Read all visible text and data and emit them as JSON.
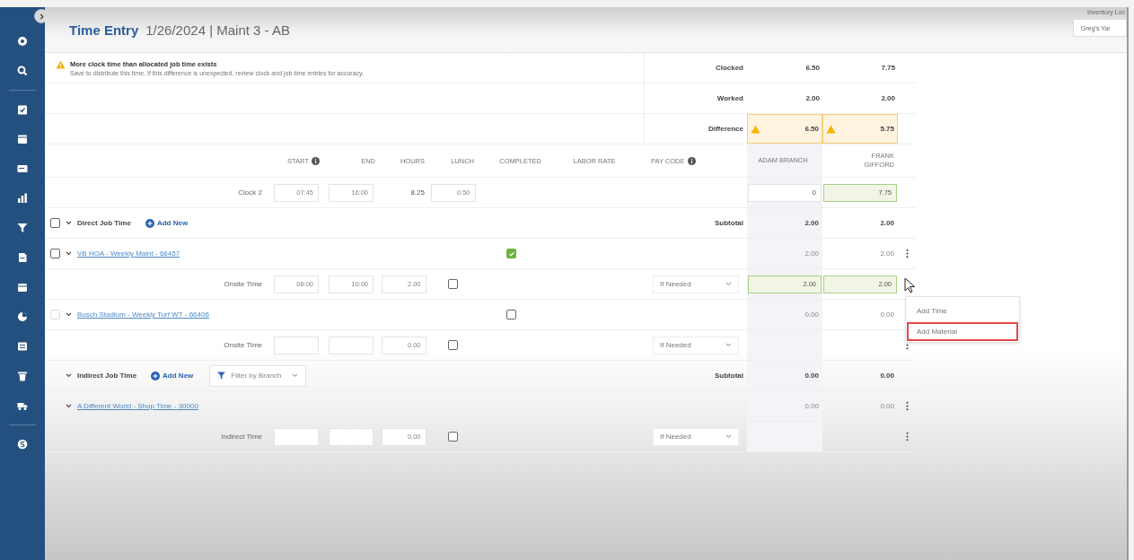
{
  "header": {
    "title": "Time Entry",
    "subtitle": "1/26/2024 | Maint 3 - AB",
    "location_label": "Inventory Loc",
    "location_value": "Greg's Yar"
  },
  "alert": {
    "title": "More clock time than allocated job time exists",
    "message": "Save to distribute this time. If this difference is unexpected, review clock and job time entries for accuracy."
  },
  "summary": [
    {
      "label": "Clocked",
      "values": [
        "6.50",
        "7.75"
      ],
      "warning": false
    },
    {
      "label": "Worked",
      "values": [
        "2.00",
        "2.00"
      ],
      "warning": false
    },
    {
      "label": "Difference",
      "values": [
        "6.50",
        "5.75"
      ],
      "warning": true
    }
  ],
  "columns": [
    {
      "label": "START",
      "info": true
    },
    {
      "label": "END",
      "info": false
    },
    {
      "label": "HOURS",
      "info": false
    },
    {
      "label": "LUNCH",
      "info": false
    },
    {
      "label": "COMPLETED",
      "info": false
    },
    {
      "label": "LABOR RATE",
      "info": false
    },
    {
      "label": "PAY CODE",
      "info": true
    }
  ],
  "employees": [
    "ADAM BRANCH",
    "FRANK GIFFORD"
  ],
  "clock_rows": [
    {
      "label": "Clock 2",
      "start": "07:45",
      "end": "16:00",
      "hours": "8.25",
      "lunch": "0.50",
      "employee_values": [
        {
          "value": "0",
          "changed": false
        },
        {
          "value": "7.75",
          "changed": true
        }
      ]
    }
  ],
  "sections": [
    {
      "title": "Direct Job Time",
      "add_label": "Add New",
      "checked": false,
      "expanded": true,
      "subtotal_label": "Subtotal",
      "subtotals": [
        "2.00",
        "2.00"
      ],
      "jobs": [
        {
          "name": "VB HOA - Weekly Maint - 66457",
          "checked": false,
          "disabled": false,
          "expanded": true,
          "completed": true,
          "menu_button": true,
          "totals": [
            "2.00",
            "2.00"
          ],
          "entries": [
            {
              "label": "Onsite Time",
              "start": "08:00",
              "end": "10:00",
              "hours": "2.00",
              "lunch_checked": false,
              "pay_code": "If Needed",
              "employee_values": [
                {
                  "value": "2.00",
                  "changed": true
                },
                {
                  "value": "2.00",
                  "changed": true
                }
              ],
              "menu": {
                "items": [
                  {
                    "label": "Add Time",
                    "highlighted": false
                  },
                  {
                    "label": "Add Material",
                    "highlighted": true
                  }
                ]
              }
            }
          ]
        },
        {
          "name": "Busch Stadium - Weekly Turf WT - 66406",
          "checked": false,
          "disabled": true,
          "expanded": true,
          "completed": false,
          "menu_button": false,
          "totals": [
            "0.00",
            "0.00"
          ],
          "entries": [
            {
              "label": "Onsite Time",
              "hours": "0.00",
              "lunch_checked": false,
              "pay_code": "If Needed"
            }
          ]
        }
      ]
    },
    {
      "title": "Indirect Job Time",
      "add_label": "Add New",
      "expanded": true,
      "filter": {
        "placeholder": "Filter by Branch"
      },
      "subtotal_label": "Subtotal",
      "subtotals": [
        "0.00",
        "0.00"
      ],
      "jobs": [
        {
          "name": "A Different World - Shop Time - 30000",
          "expanded": true,
          "menu_button": true,
          "totals": [
            "0.00",
            "0.00"
          ],
          "entries": [
            {
              "label": "Indirect Time",
              "hours": "0.00",
              "lunch_checked": false,
              "pay_code": "If Needed"
            }
          ]
        }
      ]
    }
  ]
}
